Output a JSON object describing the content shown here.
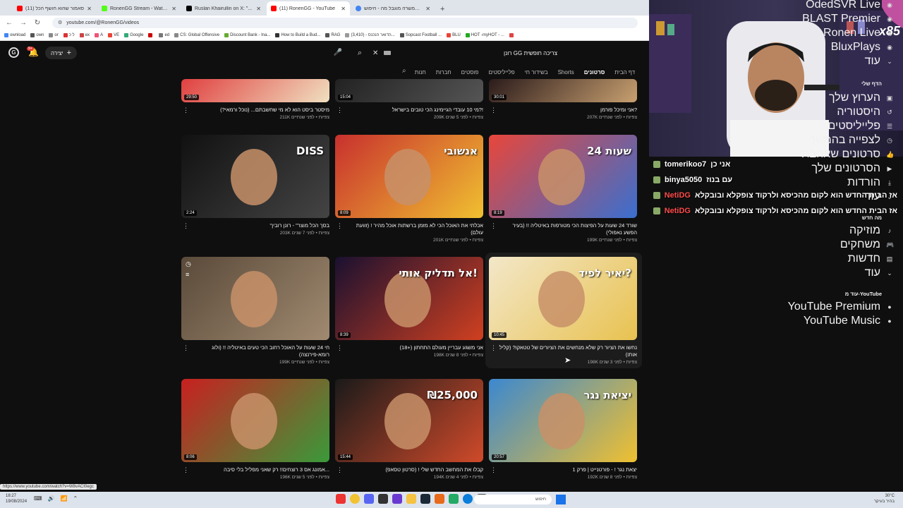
{
  "browser": {
    "tabs": [
      {
        "title": "(11) סאמור שהוא חושף הכל",
        "color": "#ff0000",
        "active": false
      },
      {
        "title": "RonenGG Stream - Watch Live",
        "color": "#53fc18",
        "active": false
      },
      {
        "title": "Ruslan Khairullin on X: \"...",
        "color": "#000000",
        "active": false
      },
      {
        "title": "(11) RonenGG - YouTube",
        "color": "#ff0000",
        "active": true
      },
      {
        "title": "מחשב המשרה מוגבל מה - חיפוש",
        "color": "#4285f4",
        "active": false
      }
    ],
    "url": "youtube.com/@RonenGG/videos",
    "bookmarks": [
      "ownload",
      "own",
      "or",
      "ל כ",
      "ex",
      "A",
      "VE",
      "Google",
      "",
      "ed",
      "CS: Global Offensive",
      "Discount Bank - Ina...",
      "How to Build a Bud...",
      "RAG",
      "(3,410) - הדואר הנכנס...",
      "Sopcast Football ...",
      "BLU",
      "HOT -myHOT - ...",
      ""
    ]
  },
  "yt": {
    "create_label": "יצירה",
    "notif_count": "9+",
    "search_value": "רונן GG צריכה חופשית",
    "channel_tabs": [
      "דף הבית",
      "סרטונים",
      "Shorts",
      "בשידור חי",
      "פלייליסטים",
      "פוסטים",
      "חברות",
      "חנות"
    ],
    "active_tab": "סרטונים"
  },
  "videos_top": [
    {
      "title": "אני ומיכל פורמן?",
      "meta": "207K צפיות • לפני שנתיים",
      "duration": "30:01"
    },
    {
      "title": "מי 10 עובדי הגיימינג הכי טובים בישראל?!",
      "meta": "209K צפיות • לפני 5 שנים",
      "duration": "15:04"
    },
    {
      "title": "מיסטר ביסט הוא לא מי שחשבתם... (נוכל ורמאי?)",
      "meta": "211K צפיות • לפני שנתיים",
      "duration": "29:50"
    }
  ],
  "videos_row2": [
    {
      "title": "שורד 24 שעות על הפיצות הכי מטורפות באיטליה !! (בעיר הפשע נאפולי)",
      "meta": "199K צפיות • לפני שנתיים",
      "duration": "8:19",
      "overlay": "24 שעות"
    },
    {
      "title": "אכלתי את האוכל הכי לא מזמן ברשתות אוכל מהיר ! (זוועת עולם)",
      "meta": "201K צפיות • לפני שנתיים",
      "duration": "8:09",
      "overlay": "אנשובי"
    },
    {
      "title": "\"בסך הכל מוצר\" - רונן רובין",
      "meta": "203K צפיות • לפני 7 שנים",
      "duration": "2:24",
      "overlay": "DISS"
    }
  ],
  "videos_row3": [
    {
      "title": "נחשו את הציור רק שלא מנחשים את הציורים של טטאקו? (קליל אותו)",
      "meta": "198K צפיות • לפני 3 שנים",
      "duration": "10:45",
      "overlay": "יאיר לפיד?"
    },
    {
      "title": "אני משגע עבריין מעולם התחתון (+18)",
      "meta": "198K צפיות • לפני 8 שנים",
      "duration": "8:39",
      "overlay": "אל תדליק אותי!"
    },
    {
      "title": "חי 24 שעות על האוכל רחוב הכי טעים באיטליה !! (ולוג רומא-פירנצה)",
      "meta": "199K צפיות • לפני שנתיים",
      "duration": "",
      "overlay": ""
    }
  ],
  "videos_row4": [
    {
      "title": "יצאת נגר ! - פורטנייט | פרק 1",
      "meta": "192K צפיות • לפני 8 שנים",
      "duration": "20:57",
      "overlay": "יציאת נגר"
    },
    {
      "title": "קבלו את המחשב החדש שלי ! (סרטון טסאפ)",
      "meta": "194K צפיות • לפני 4 שנים",
      "duration": "15:44",
      "overlay": "₪25,000"
    },
    {
      "title": "אמונג אס 3 רוצחים!! רק שאני מפליל בלי סיבה...",
      "meta": "196K צפיות • לפני 5 שנים",
      "duration": "8:06",
      "overlay": ""
    }
  ],
  "stream": {
    "badge": "x85",
    "chat": [
      {
        "user": "tomerikoo7",
        "msg": "אני כן",
        "red": false
      },
      {
        "user": "binya5050",
        "msg": "עם בנוז",
        "red": false
      },
      {
        "user": "NetiDG",
        "msg": "אז הבית החדש הוא לקום מהכיסא ולרקוד צופקלא ובובקלא",
        "red": true
      },
      {
        "user": "NetiDG",
        "msg": "אז הבית החדש הוא לקום מהכיסא ולרקוד צופקלא ובובקלא",
        "red": true
      }
    ]
  },
  "guide": {
    "subs": [
      "OdedSVR Live",
      "BLAST Premier",
      "Ronen Live",
      "BluxPlays"
    ],
    "more": "עוד",
    "you_section": "הדף שלי",
    "you_items": [
      "הערוץ שלך",
      "היסטוריה",
      "פלייליסטים",
      "לצפייה בהמשך",
      "סרטונים שאהבתי",
      "הסרטונים שלך",
      "הורדות",
      "עוד"
    ],
    "explore_title": "מה חדש",
    "explore_items": [
      "מוזיקה",
      "משחקים",
      "חדשות",
      "עוד"
    ],
    "more_yt_title": "עוד מ-YouTube",
    "more_yt_items": [
      "YouTube Premium",
      "YouTube Music"
    ]
  },
  "status_url": "https://www.youtube.com/watch?v=W8vACI0egc",
  "taskbar": {
    "time": "18:27",
    "date": "19/08/2024",
    "search_placeholder": "חיפוש",
    "weather": "30°C",
    "weather_desc": "בהיר בעיקר"
  }
}
